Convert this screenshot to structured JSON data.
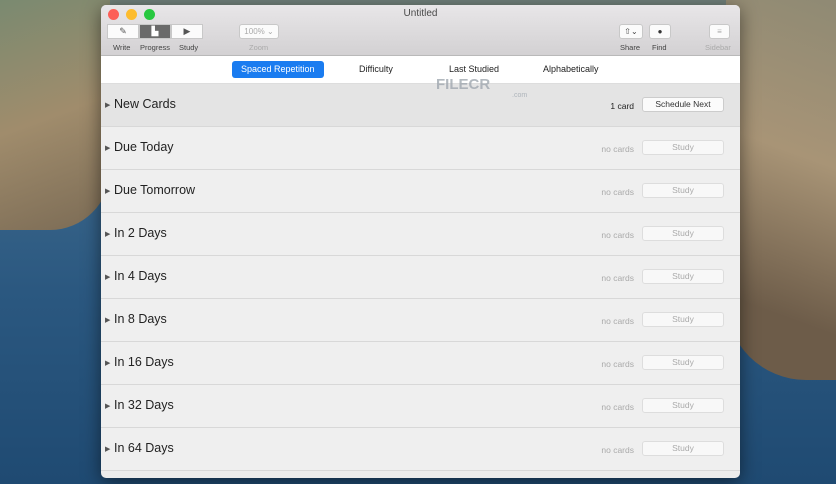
{
  "window": {
    "title": "Untitled"
  },
  "toolbar": {
    "write": "Write",
    "progress": "Progress",
    "study": "Study",
    "zoom_value": "100%",
    "zoom": "Zoom",
    "share": "Share",
    "find": "Find",
    "sidebar": "Sidebar"
  },
  "tabs": [
    "Spaced Repetition",
    "Difficulty",
    "Last Studied",
    "Alphabetically"
  ],
  "watermark": {
    "name": "FILECR",
    "sub": ".com"
  },
  "rows": [
    {
      "name": "New Cards",
      "count": "1 card",
      "action": "Schedule Next"
    },
    {
      "name": "Due Today",
      "count": "no cards",
      "action": "Study"
    },
    {
      "name": "Due Tomorrow",
      "count": "no cards",
      "action": "Study"
    },
    {
      "name": "In 2 Days",
      "count": "no cards",
      "action": "Study"
    },
    {
      "name": "In 4 Days",
      "count": "no cards",
      "action": "Study"
    },
    {
      "name": "In 8 Days",
      "count": "no cards",
      "action": "Study"
    },
    {
      "name": "In 16 Days",
      "count": "no cards",
      "action": "Study"
    },
    {
      "name": "In 32 Days",
      "count": "no cards",
      "action": "Study"
    },
    {
      "name": "In 64 Days",
      "count": "no cards",
      "action": "Study"
    }
  ]
}
